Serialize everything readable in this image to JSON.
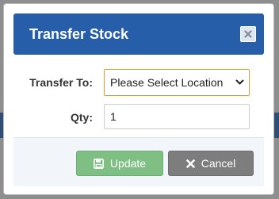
{
  "modal": {
    "title": "Transfer Stock",
    "close_icon": "close-icon"
  },
  "form": {
    "transfer_to_label": "Transfer To:",
    "transfer_to_selected": "Please Select Location",
    "qty_label": "Qty:",
    "qty_value": "1"
  },
  "footer": {
    "update_label": "Update",
    "update_icon": "floppy-disk-icon",
    "cancel_label": "Cancel",
    "cancel_icon": "x-icon"
  },
  "colors": {
    "header_bg": "#275ea9",
    "select_border": "#e39a2d",
    "update_bg": "#7fbf84",
    "cancel_bg": "#7d7d7d"
  }
}
